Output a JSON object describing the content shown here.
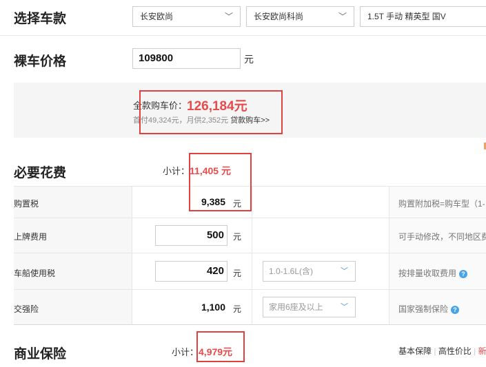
{
  "select_model": {
    "title": "选择车款",
    "brand": "长安欧尚",
    "series": "长安欧尚科尚",
    "trim": "1.5T 手动 精英型 国V"
  },
  "bare_price": {
    "title": "裸车价格",
    "value": "109800",
    "unit": "元"
  },
  "summary": {
    "total_label": "全款购车价：",
    "total_value": "126,184元",
    "sub_text": "首付49,324元，月供2,352元",
    "loan_link": "贷款购车>>"
  },
  "required": {
    "title": "必要花费",
    "subtotal_label": "小计：",
    "subtotal_value": "11,405 元",
    "rows": [
      {
        "label": "购置税",
        "value": "9,385",
        "unit": "元",
        "note": "购置附加税=购车型（1-"
      },
      {
        "label": "上牌费用",
        "value": "500",
        "unit": "元",
        "note": "可手动修改，不同地区费"
      },
      {
        "label": "车船使用税",
        "value": "420",
        "unit": "元",
        "dropdown": "1.0-1.6L(含)",
        "note": "按排量收取费用"
      },
      {
        "label": "交强险",
        "value": "1,100",
        "unit": "元",
        "dropdown": "家用6座及以上",
        "note": "国家强制保险"
      }
    ]
  },
  "insurance": {
    "title": "商业保险",
    "subtotal_label": "小计：",
    "subtotal_value": "4,979元",
    "options": [
      "基本保障",
      "高性价比",
      "新"
    ]
  },
  "icons": {
    "chevron": "chevron-down-icon",
    "help": "question-mark-icon"
  },
  "colors": {
    "accent_red": "#e84a4a",
    "box_red": "#e0403f",
    "help_blue": "#4aa3e6"
  }
}
